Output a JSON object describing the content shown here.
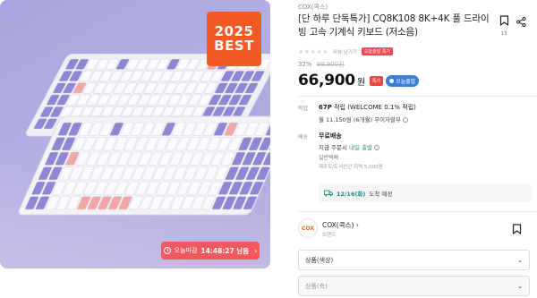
{
  "hero": {
    "badge_year": "2025",
    "badge_text": "BEST",
    "timer_label": "오늘마감",
    "timer_time": "14:48:27 남음",
    "timer_arrow": "›"
  },
  "product": {
    "brand": "COX(콕스)",
    "title": "[단 하루 단독특가] CQ8K108 8K+4K 풀 드라이빙 고속 기계식 키보드 (저소음)",
    "save_count": "13",
    "stars": "★★★★★",
    "review_link": "리뷰 남기기",
    "review_tag": "오늘출발 특가",
    "discount_rate": "32%",
    "original_price": "99,900원",
    "price": "66,900",
    "price_unit": "원",
    "special_badge": "특가",
    "today_badge": "오늘출발"
  },
  "points": {
    "label": "적립",
    "amount": "67P",
    "amount_suffix": " 적립 (WELCOME 0.1% 적립)",
    "installment": "월 11,150원 (6개월) 무이자할부"
  },
  "shipping": {
    "label": "배송",
    "title": "무료배송",
    "line2_prefix": "지금 주문시 ",
    "line2_highlight": "내일 출발",
    "line3": "일반택배",
    "line4": "제주도/도서산간 지역 5,000원",
    "arrival_date": "12/16(화)",
    "arrival_text": "도착 예정"
  },
  "brand_card": {
    "logo_text": "COX",
    "name": "COX(콕스) ›",
    "sub": "브랜드"
  },
  "options": {
    "option1": "상품(색상)",
    "option2": "상품(축)"
  },
  "colors": {
    "accent_orange": "#f15a24",
    "timer_red": "#f2595e",
    "keycap_lavender": "#8f86d4",
    "keycap_pink": "#f2a7a5",
    "today_blue": "#3b7dd8"
  }
}
